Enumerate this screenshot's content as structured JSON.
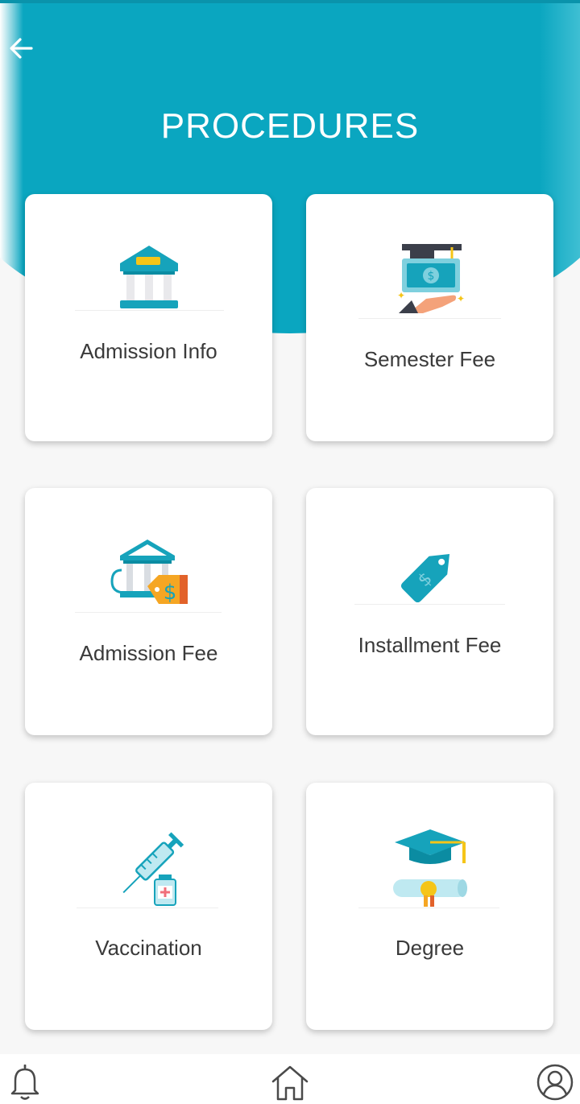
{
  "header": {
    "title": "PROCEDURES",
    "back_icon": "arrow-left-icon",
    "accent_color": "#0aa6c0"
  },
  "cards": [
    {
      "label": "Admission Info",
      "icon": "bank-icon"
    },
    {
      "label": "Semester Fee",
      "icon": "graduation-money-icon"
    },
    {
      "label": "Admission Fee",
      "icon": "bank-price-tag-icon"
    },
    {
      "label": "Installment Fee",
      "icon": "price-tag-icon"
    },
    {
      "label": "Vaccination",
      "icon": "syringe-icon"
    },
    {
      "label": "Degree",
      "icon": "diploma-cap-icon"
    }
  ],
  "bottom_nav": {
    "items": [
      {
        "icon": "bell-icon"
      },
      {
        "icon": "home-icon"
      },
      {
        "icon": "user-profile-icon"
      }
    ]
  }
}
